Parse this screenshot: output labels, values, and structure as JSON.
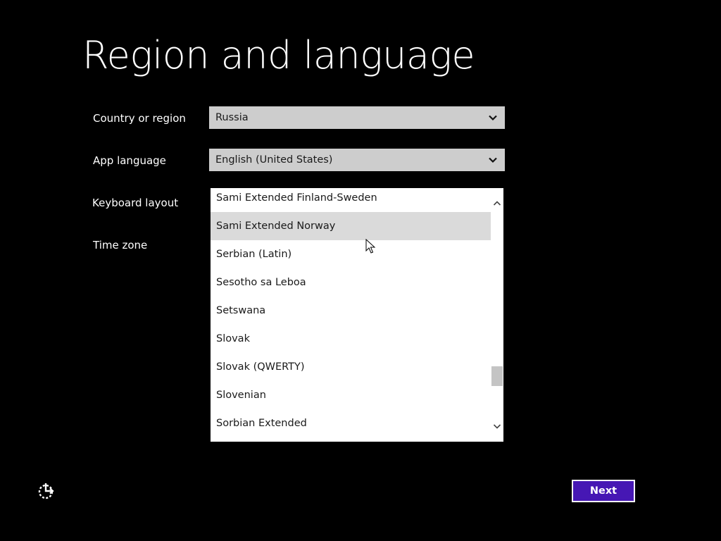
{
  "page": {
    "title": "Region and language"
  },
  "fields": {
    "country": {
      "label": "Country or region",
      "value": "Russia"
    },
    "app_language": {
      "label": "App language",
      "value": "English (United States)"
    },
    "keyboard": {
      "label": "Keyboard layout",
      "options": [
        "Sami Extended Finland-Sweden",
        "Sami Extended Norway",
        "Serbian (Latin)",
        "Sesotho sa Leboa",
        "Setswana",
        "Slovak",
        "Slovak (QWERTY)",
        "Slovenian",
        "Sorbian Extended"
      ],
      "hovered_option": "Sami Extended Norway"
    },
    "timezone": {
      "label": "Time zone"
    }
  },
  "footer": {
    "next_label": "Next",
    "ease_of_access_icon": "ease-of-access-icon"
  },
  "colors": {
    "background": "#000000",
    "accent": "#4617b4",
    "select_bg": "#cdcdcd",
    "list_hover": "#dadada"
  }
}
